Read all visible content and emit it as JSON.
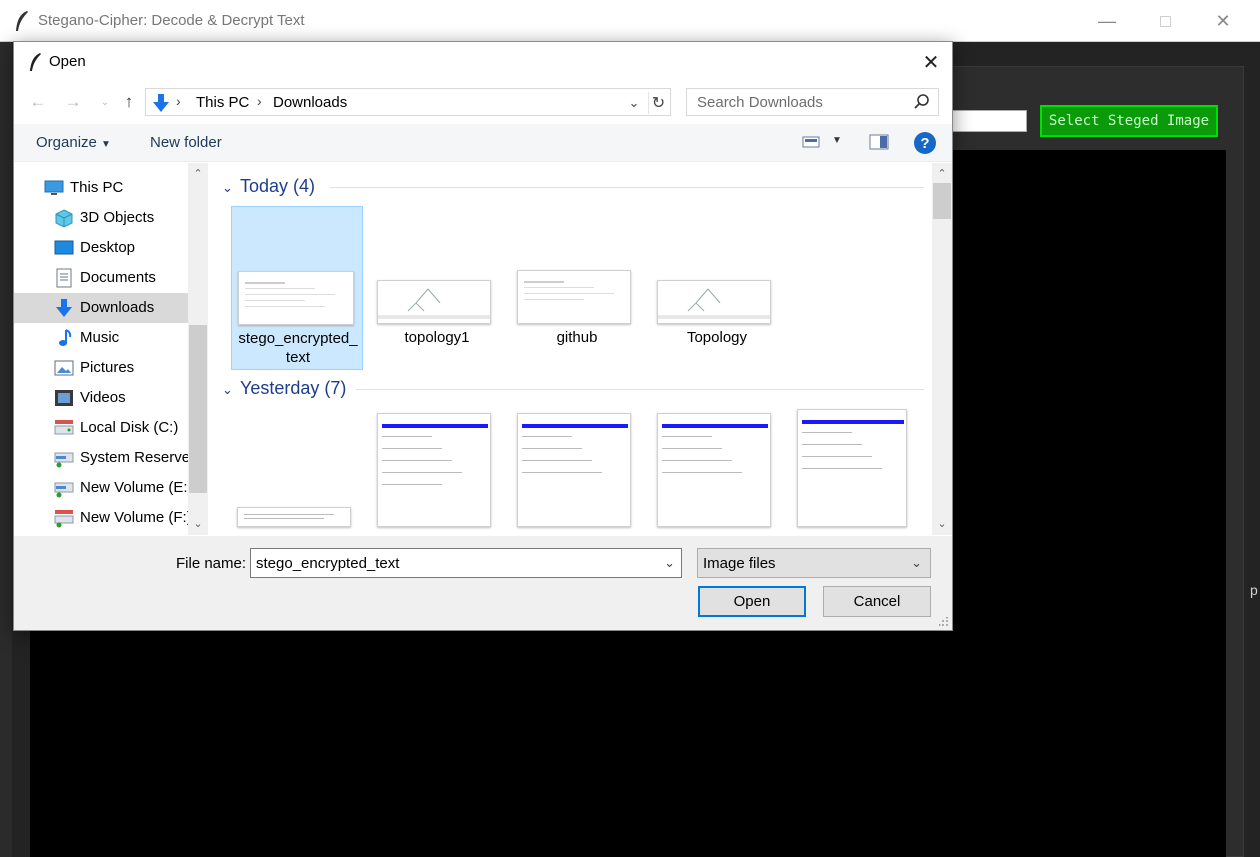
{
  "app": {
    "title": "Stegano-Cipher: Decode & Decrypt Text",
    "select_button": "Select Steged Image",
    "window_controls": [
      "minimize",
      "maximize",
      "close"
    ],
    "right_edge_glyph": "p"
  },
  "dialog": {
    "title": "Open",
    "address": {
      "crumbs": [
        "This PC",
        "Downloads"
      ]
    },
    "search_placeholder": "Search Downloads",
    "toolbar": {
      "organize": "Organize",
      "new_folder": "New folder"
    },
    "nav_items": [
      {
        "label": "This PC",
        "icon": "computer-icon"
      },
      {
        "label": "3D Objects",
        "icon": "cube-icon"
      },
      {
        "label": "Desktop",
        "icon": "desktop-icon"
      },
      {
        "label": "Documents",
        "icon": "document-icon"
      },
      {
        "label": "Downloads",
        "icon": "download-icon",
        "selected": true
      },
      {
        "label": "Music",
        "icon": "music-icon"
      },
      {
        "label": "Pictures",
        "icon": "pictures-icon"
      },
      {
        "label": "Videos",
        "icon": "videos-icon"
      },
      {
        "label": "Local Disk (C:)",
        "icon": "drive-icon"
      },
      {
        "label": "System Reservec",
        "icon": "drive-icon"
      },
      {
        "label": "New Volume (E:)",
        "icon": "drive-icon"
      },
      {
        "label": "New Volume (F:)",
        "icon": "drive-icon"
      }
    ],
    "groups": [
      {
        "header": "Today (4)",
        "files": [
          {
            "name_line1": "stego_encrypted_",
            "name_line2": "text",
            "selected": true
          },
          {
            "name_line1": "topology1"
          },
          {
            "name_line1": "github"
          },
          {
            "name_line1": "Topology"
          }
        ]
      },
      {
        "header": "Yesterday (7)"
      }
    ],
    "file_name_label": "File name:",
    "file_name_value": "stego_encrypted_text",
    "file_type_value": "Image files",
    "open_button": "Open",
    "cancel_button": "Cancel"
  }
}
